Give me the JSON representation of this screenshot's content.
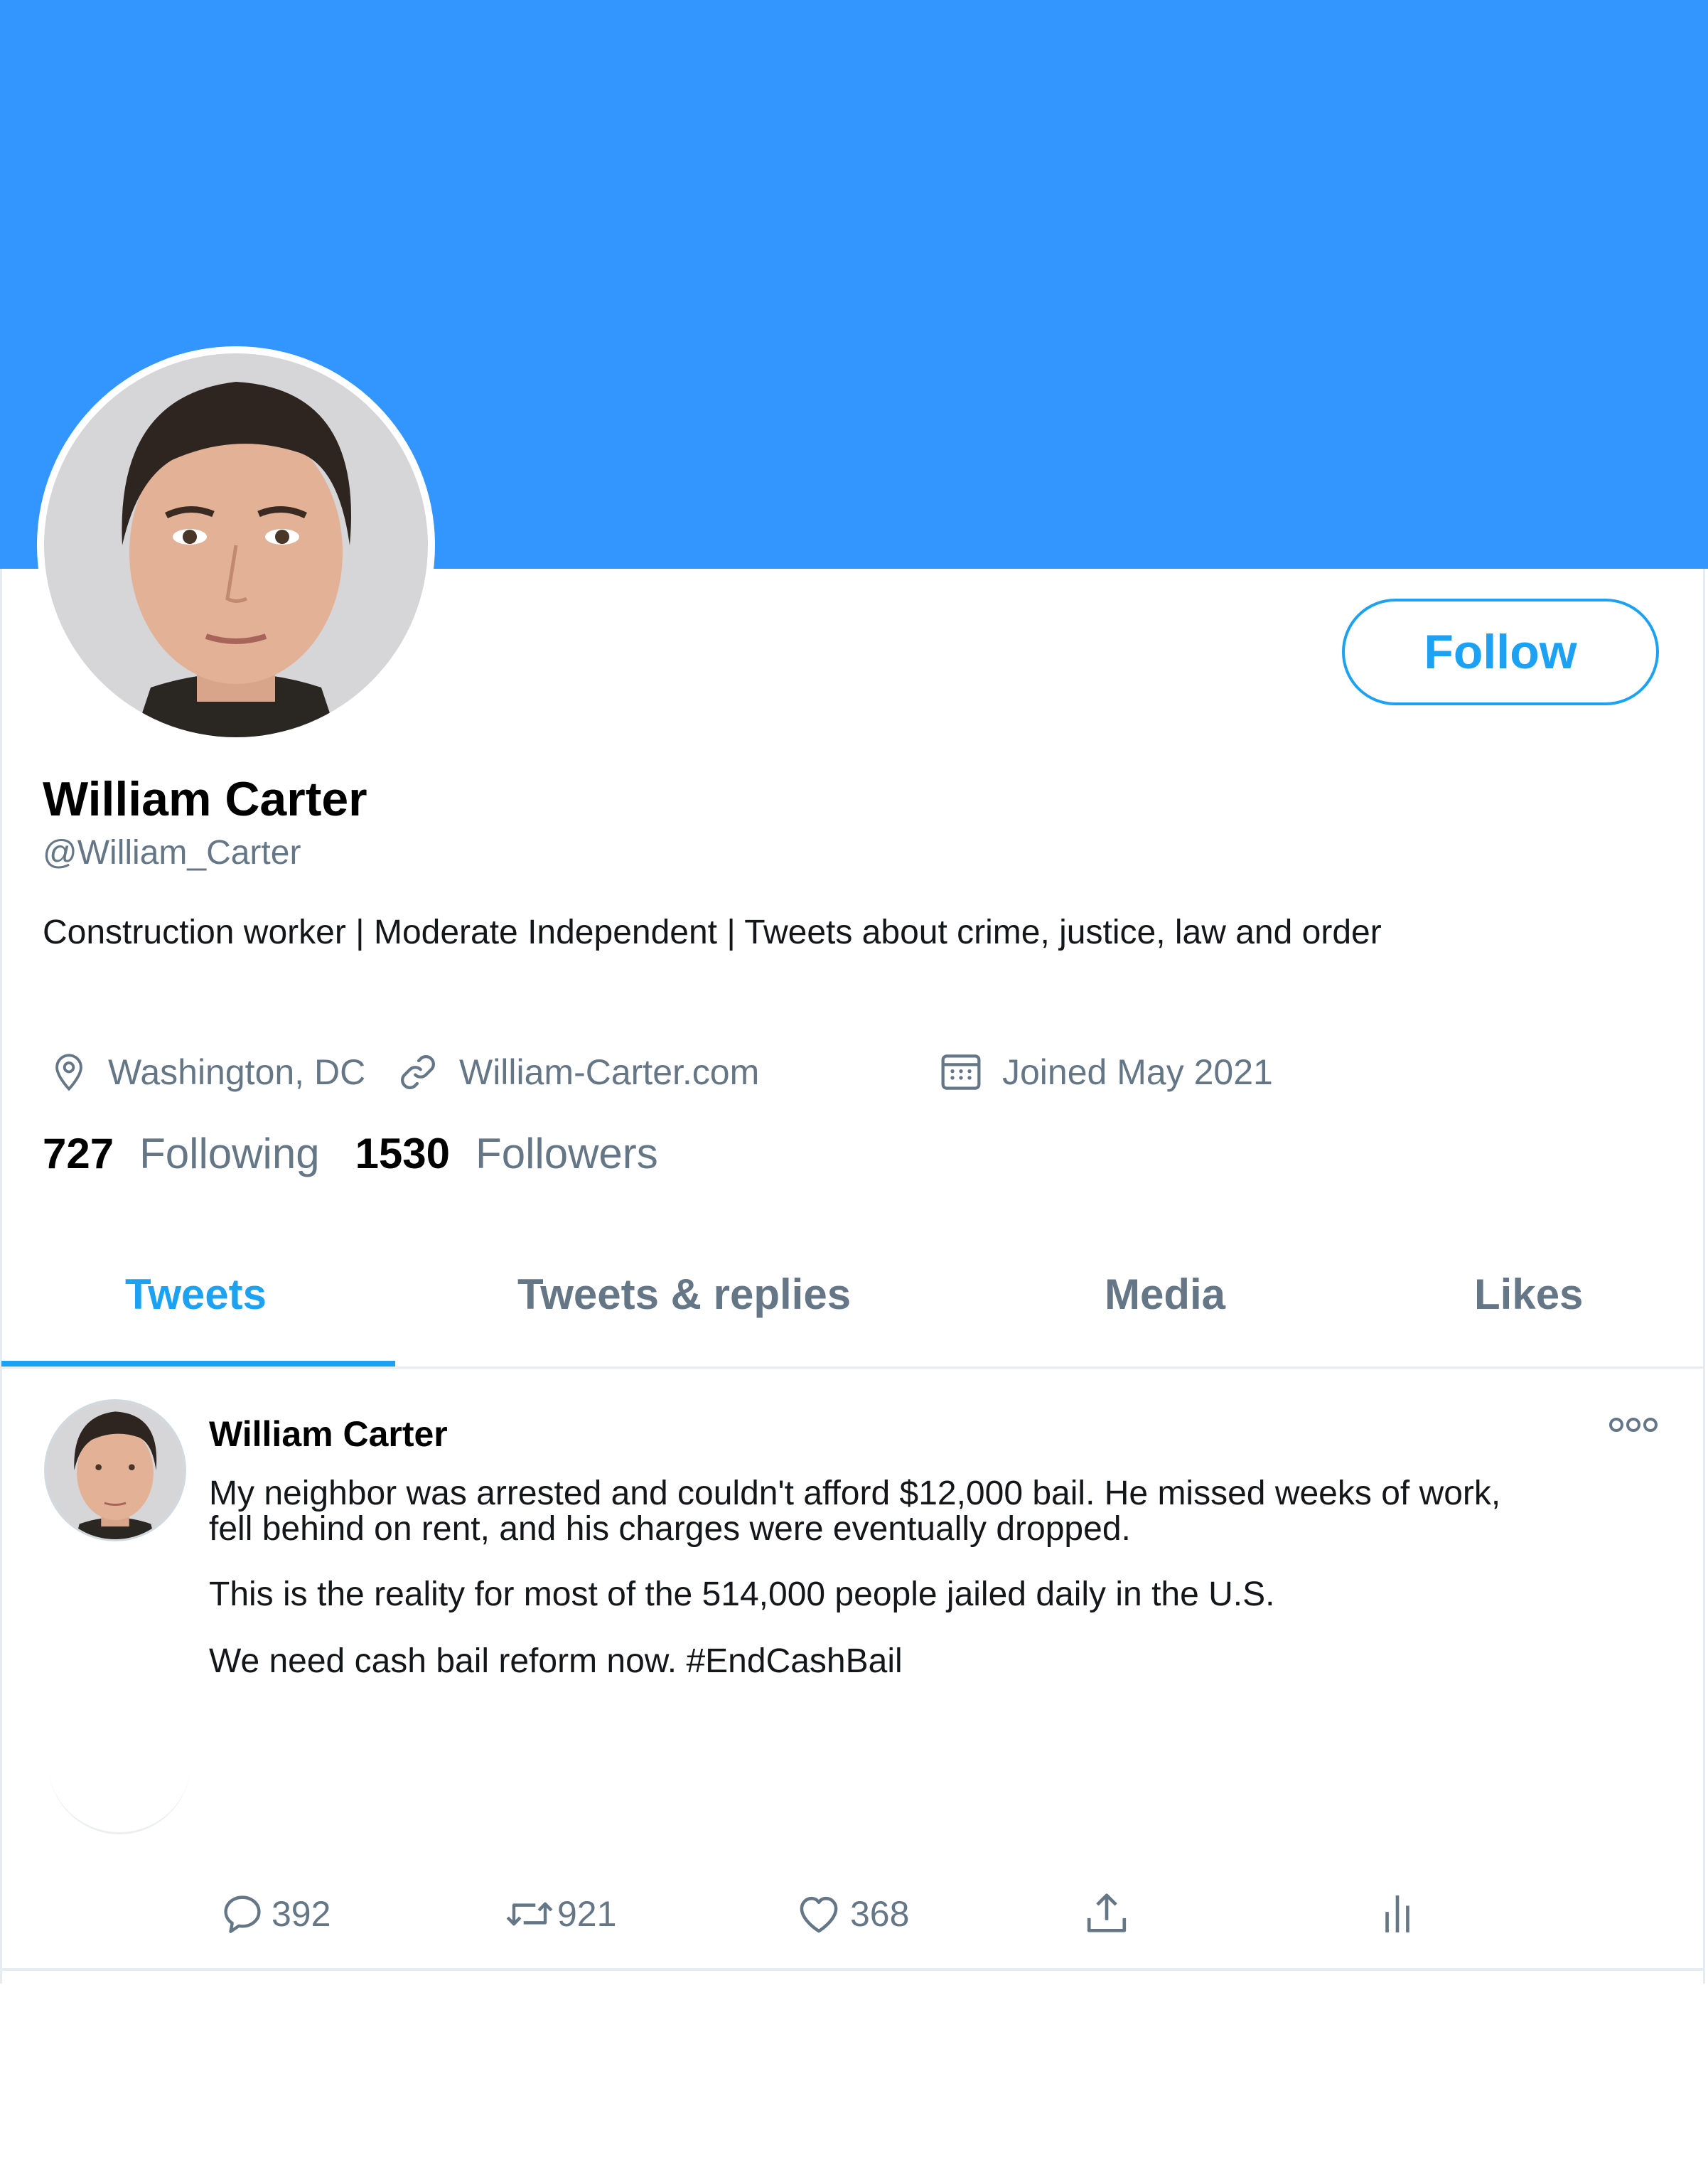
{
  "profile": {
    "name": "William Carter",
    "handle": "@William_Carter",
    "bio": "Construction worker | Moderate Independent | Tweets about crime, justice, law and order",
    "location": "Washington, DC",
    "website": "William-Carter.com",
    "joined": "Joined May 2021",
    "following_count": "727",
    "following_label": "Following",
    "followers_count": "1530",
    "followers_label": "Followers",
    "follow_label": "Follow"
  },
  "tabs": [
    {
      "label": "Tweets",
      "active": true
    },
    {
      "label": "Tweets & replies",
      "active": false
    },
    {
      "label": "Media",
      "active": false
    },
    {
      "label": "Likes",
      "active": false
    }
  ],
  "tweet": {
    "author": "William Carter",
    "lines": [
      "My neighbor was arrested and couldn't afford $12,000 bail. He missed weeks of work,",
      "fell behind on rent, and his charges were eventually dropped.",
      "This is the reality for most of the 514,000 people jailed daily in the U.S.",
      "We need cash bail reform now. #EndCashBail"
    ],
    "replies": "392",
    "retweets": "921",
    "likes": "368"
  },
  "icons": {
    "location": "map-pin-icon",
    "website": "link-icon",
    "joined": "calendar-icon",
    "more": "more-options-icon",
    "reply": "reply-icon",
    "retweet": "retweet-icon",
    "like": "heart-icon",
    "share": "share-icon",
    "analytics": "analytics-icon"
  },
  "colors": {
    "banner": "#3396ff",
    "accent": "#1da1f2",
    "secondary_text": "#657786"
  }
}
